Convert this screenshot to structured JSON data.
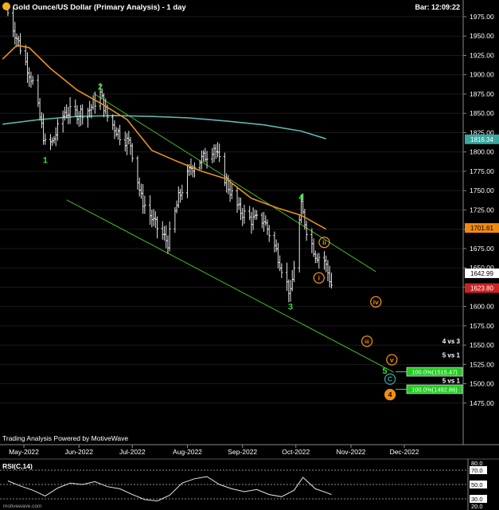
{
  "header": {
    "title": "Gold Ounce/US Dollar (Primary Analysis) - 1 day",
    "bar_time": "Bar: 12:09:22",
    "icon": "gold-circle-icon"
  },
  "footer": {
    "powered_by": "Trading Analysis Powered by MotiveWave",
    "watermark": "motivewave.com"
  },
  "colors": {
    "background": "#000000",
    "wave_green": "#33dd33",
    "wave_orange": "#f09010",
    "ma_orange": "#e8921e",
    "ma_teal": "#5fb8b0",
    "channel": "#44bb22",
    "price_bar": "#e6e6e6",
    "last_price_bg": "#cc2222",
    "teal_tag_bg": "#3aa6a0",
    "orange_tag_bg": "#f08a10",
    "white_tag_bg": "#ffffff"
  },
  "chart_data": [
    {
      "type": "ohlc",
      "title": "Gold Ounce/US Dollar (Primary Analysis) - 1 day",
      "x_ticks": [
        "May-2022",
        "Jun-2022",
        "Jul-2022",
        "Aug-2022",
        "Sep-2022",
        "Oct-2022",
        "Nov-2022",
        "Dec-2022"
      ],
      "ylim": [
        1458,
        1992
      ],
      "y_ticks": [
        1475,
        1500,
        1525,
        1550,
        1575,
        1600,
        1625,
        1650,
        1675,
        1700,
        1725,
        1750,
        1775,
        1800,
        1825,
        1850,
        1875,
        1900,
        1925,
        1950,
        1975
      ],
      "price_path": [
        [
          "2022-04-22",
          1980
        ],
        [
          "2022-04-29",
          1935
        ],
        [
          "2022-05-06",
          1890
        ],
        [
          "2022-05-13",
          1810
        ],
        [
          "2022-05-17",
          1812
        ],
        [
          "2022-05-24",
          1852
        ],
        [
          "2022-05-31",
          1850
        ],
        [
          "2022-06-07",
          1855
        ],
        [
          "2022-06-13",
          1875
        ],
        [
          "2022-06-17",
          1845
        ],
        [
          "2022-06-24",
          1822
        ],
        [
          "2022-06-30",
          1810
        ],
        [
          "2022-07-06",
          1740
        ],
        [
          "2022-07-14",
          1705
        ],
        [
          "2022-07-21",
          1683
        ],
        [
          "2022-07-27",
          1740
        ],
        [
          "2022-08-03",
          1780
        ],
        [
          "2022-08-10",
          1792
        ],
        [
          "2022-08-16",
          1807
        ],
        [
          "2022-08-23",
          1760
        ],
        [
          "2022-08-30",
          1725
        ],
        [
          "2022-09-06",
          1712
        ],
        [
          "2022-09-13",
          1712
        ],
        [
          "2022-09-20",
          1672
        ],
        [
          "2022-09-28",
          1615
        ],
        [
          "2022-10-04",
          1729
        ],
        [
          "2022-10-07",
          1700
        ],
        [
          "2022-10-12",
          1668
        ],
        [
          "2022-10-17",
          1660
        ],
        [
          "2022-10-21",
          1628
        ]
      ],
      "ma_fast": [
        [
          "2022-04-19",
          1920
        ],
        [
          "2022-04-27",
          1938
        ],
        [
          "2022-05-04",
          1935
        ],
        [
          "2022-05-16",
          1908
        ],
        [
          "2022-05-31",
          1880
        ],
        [
          "2022-06-14",
          1862
        ],
        [
          "2022-06-28",
          1842
        ],
        [
          "2022-07-12",
          1802
        ],
        [
          "2022-07-26",
          1788
        ],
        [
          "2022-08-09",
          1775
        ],
        [
          "2022-08-23",
          1765
        ],
        [
          "2022-09-06",
          1740
        ],
        [
          "2022-09-20",
          1728
        ],
        [
          "2022-10-04",
          1718
        ],
        [
          "2022-10-18",
          1700
        ]
      ],
      "ma_slow": [
        [
          "2022-04-19",
          1836
        ],
        [
          "2022-05-10",
          1842
        ],
        [
          "2022-05-31",
          1846
        ],
        [
          "2022-06-21",
          1847
        ],
        [
          "2022-07-12",
          1846
        ],
        [
          "2022-08-02",
          1844
        ],
        [
          "2022-08-23",
          1840
        ],
        [
          "2022-09-13",
          1835
        ],
        [
          "2022-10-04",
          1827
        ],
        [
          "2022-10-18",
          1817
        ]
      ],
      "channel_lines": [
        {
          "points": [
            [
              "2022-06-09",
              1876
            ],
            [
              "2022-11-15",
              1645
            ]
          ]
        },
        {
          "points": [
            [
              "2022-05-25",
              1738
            ],
            [
              "2022-11-25",
              1515
            ]
          ]
        }
      ],
      "wave_labels": [
        {
          "text": "1",
          "date": "2022-05-13",
          "price": 1790,
          "style": "plain-green"
        },
        {
          "text": "2",
          "date": "2022-06-13",
          "price": 1885,
          "style": "plain-green"
        },
        {
          "text": "3",
          "date": "2022-09-28",
          "price": 1600,
          "style": "plain-green"
        },
        {
          "text": "4",
          "date": "2022-10-04",
          "price": 1742,
          "style": "plain-green"
        },
        {
          "text": "5",
          "date": "2022-11-20",
          "price": 1517,
          "style": "plain-green"
        },
        {
          "text": "i",
          "date": "2022-10-14",
          "price": 1637,
          "style": "circle-orange"
        },
        {
          "text": "ii",
          "date": "2022-10-17",
          "price": 1683,
          "style": "circle-orange"
        },
        {
          "text": "iii",
          "date": "2022-11-10",
          "price": 1555,
          "style": "circle-orange"
        },
        {
          "text": "iv",
          "date": "2022-11-15",
          "price": 1606,
          "style": "circle-orange"
        },
        {
          "text": "v",
          "date": "2022-11-24",
          "price": 1531,
          "style": "circle-orange"
        },
        {
          "text": "C",
          "date": "2022-11-23",
          "price": 1506,
          "style": "circle-teal"
        },
        {
          "text": "4",
          "date": "2022-11-23",
          "price": 1486,
          "style": "circle-filled-orange"
        }
      ],
      "projections": [
        {
          "heading": "4 vs 3",
          "heading_price": 1555
        },
        {
          "heading": "5 vs 1",
          "heading_price": 1537,
          "label": "100.0%(1515.47)",
          "price": 1515.47
        },
        {
          "heading": "5 vs 1",
          "heading_price": 1504,
          "label": "100.0%(1492.86)",
          "price": 1492.86
        }
      ],
      "price_tags": [
        {
          "value": "1816.34",
          "price": 1816.34,
          "style": "teal"
        },
        {
          "value": "1701.61",
          "price": 1701.61,
          "style": "orange"
        },
        {
          "value": "1642.99",
          "price": 1642.99,
          "style": "white"
        },
        {
          "value": "1623.80",
          "price": 1623.8,
          "style": "red"
        }
      ]
    },
    {
      "type": "line",
      "title": "RSI(C,14)",
      "ylim": [
        20,
        80
      ],
      "y_ticks": [
        20,
        30,
        50,
        70,
        80
      ],
      "levels": [
        30,
        50,
        70
      ],
      "series": [
        {
          "x": [
            "2022-04-22",
            "2022-04-29",
            "2022-05-06",
            "2022-05-13",
            "2022-05-20",
            "2022-05-27",
            "2022-06-03",
            "2022-06-10",
            "2022-06-17",
            "2022-06-24",
            "2022-07-01",
            "2022-07-08",
            "2022-07-15",
            "2022-07-22",
            "2022-07-29",
            "2022-08-05",
            "2022-08-12",
            "2022-08-19",
            "2022-08-26",
            "2022-09-02",
            "2022-09-09",
            "2022-09-16",
            "2022-09-23",
            "2022-09-30",
            "2022-10-05",
            "2022-10-12",
            "2022-10-19",
            "2022-10-21"
          ],
          "values": [
            55,
            48,
            42,
            34,
            45,
            52,
            50,
            54,
            47,
            44,
            36,
            29,
            27,
            35,
            52,
            58,
            61,
            50,
            44,
            40,
            43,
            36,
            33,
            42,
            60,
            44,
            38,
            36
          ]
        }
      ]
    }
  ]
}
